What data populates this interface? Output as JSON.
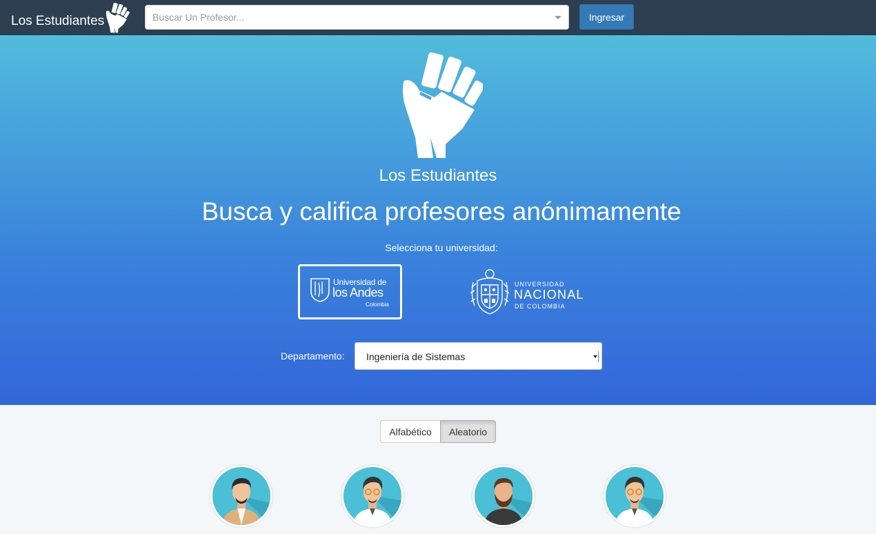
{
  "navbar": {
    "brand": "Los Estudiantes",
    "search_placeholder": "Buscar Un Profesor...",
    "login_label": "Ingresar"
  },
  "hero": {
    "brand": "Los Estudiantes",
    "title": "Busca y califica profesores anónimamente",
    "university_prompt": "Selecciona tu universidad:",
    "universities": [
      {
        "line1": "Universidad de",
        "line2": "los Andes",
        "line3": "Colombia",
        "selected": true
      },
      {
        "line1": "UNIVERSIDAD",
        "line2": "NACIONAL",
        "line3": "DE COLOMBIA",
        "selected": false
      }
    ],
    "department_label": "Departamento:",
    "department_value": "Ingeniería de Sistemas"
  },
  "sort": {
    "alphabetic_label": "Alfabético",
    "random_label": "Aleatorio",
    "active": "random"
  },
  "professors": [
    {
      "avatar": "avatar-man-dark-hair-brown-jacket"
    },
    {
      "avatar": "avatar-man-glasses-white-shirt"
    },
    {
      "avatar": "avatar-man-beard-dark-shirt"
    },
    {
      "avatar": "avatar-man-glasses-white-shirt"
    }
  ],
  "colors": {
    "navbar": "#2c3e50",
    "hero_top": "#52bcdc",
    "hero_bottom": "#3366d9",
    "button_primary": "#337ab7",
    "avatar_bg": "#4bbfd6"
  }
}
